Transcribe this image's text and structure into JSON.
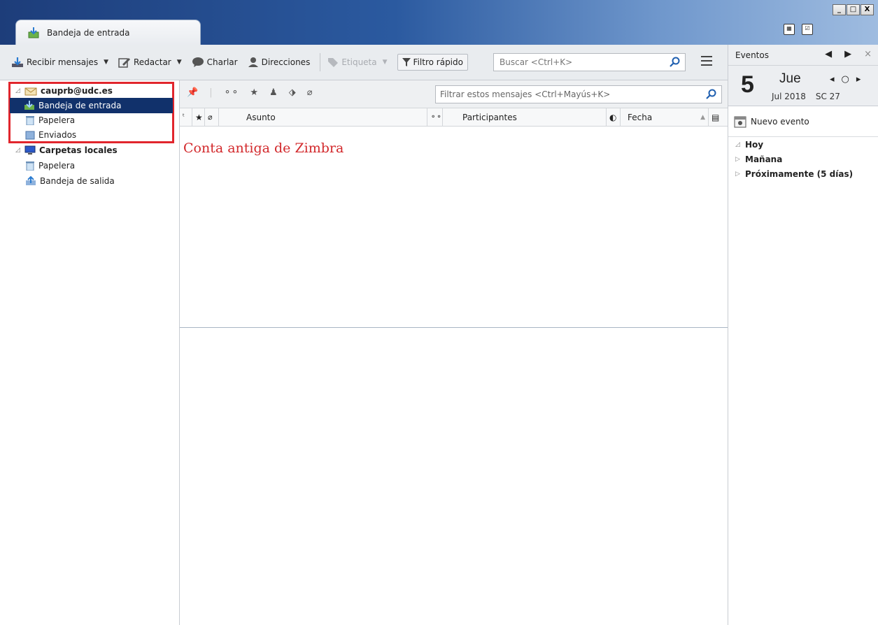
{
  "window": {
    "tab_label": "Bandeja de entrada",
    "buttons": [
      "_",
      "□",
      "X"
    ]
  },
  "toolbar": {
    "get_mail": "Recibir mensajes",
    "write": "Redactar",
    "chat": "Charlar",
    "address_book": "Direcciones",
    "tag": "Etiqueta",
    "quick_filter": "Filtro rápido",
    "search_placeholder": "Buscar <Ctrl+K>"
  },
  "folders": {
    "account": "cauprb@udc.es",
    "account_items": [
      "Bandeja de entrada",
      "Papelera",
      "Enviados"
    ],
    "local": "Carpetas locales",
    "local_items": [
      "Papelera",
      "Bandeja de salida"
    ]
  },
  "threadpane": {
    "filter_placeholder": "Filtrar estos mensajes <Ctrl+Mayús+K>",
    "columns": {
      "subject": "Asunto",
      "participants": "Participantes",
      "date": "Fecha"
    },
    "annotation": "Conta antiga de Zimbra"
  },
  "today": {
    "title": "Eventos",
    "day_number": "5",
    "day_name": "Jue",
    "month_year": "Jul 2018",
    "week": "SC 27",
    "new_event": "Nuevo evento",
    "agenda": [
      "Hoy",
      "Mañana",
      "Próximamente (5 días)"
    ]
  },
  "colors": {
    "selection": "#11316b",
    "highlight_box": "#e1262d",
    "annotation": "#d2282b"
  }
}
